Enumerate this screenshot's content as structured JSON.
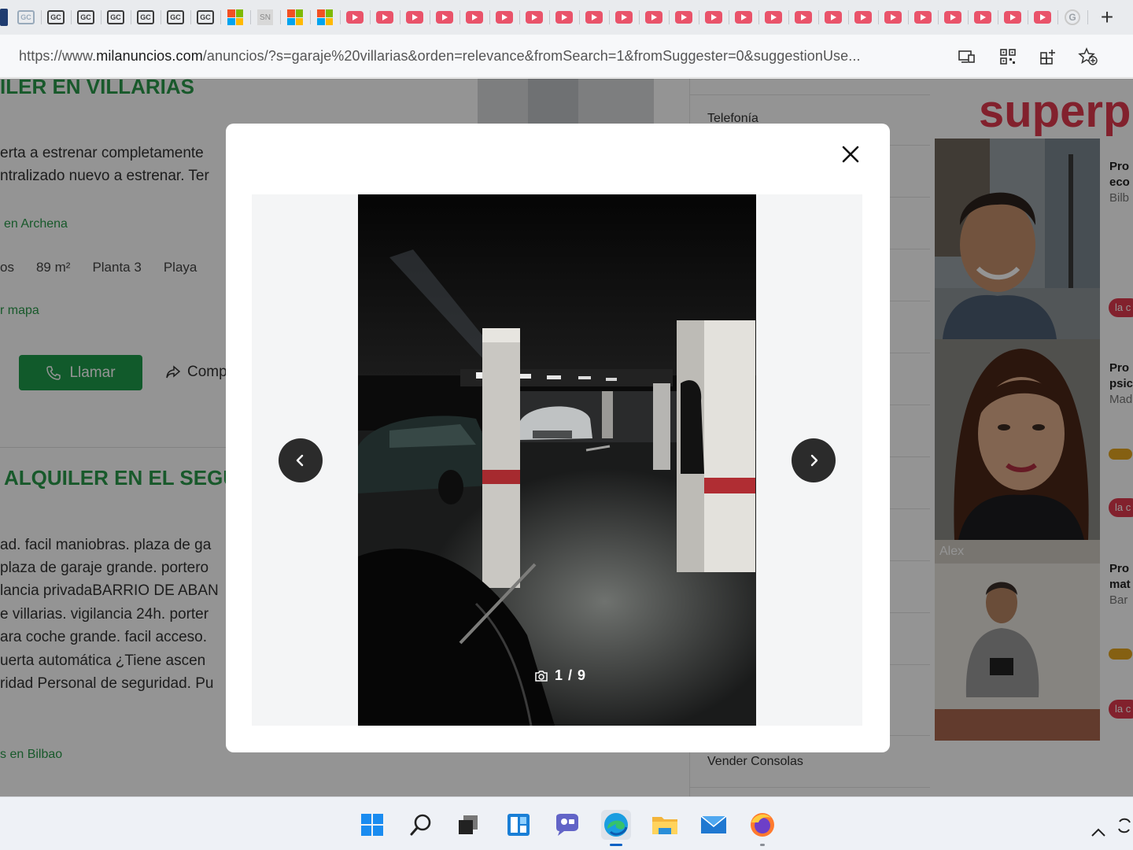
{
  "browser": {
    "tabs": [
      {
        "icon": "generic-dark-icon"
      },
      {
        "icon": "gc-icon",
        "label": "GC"
      },
      {
        "icon": "gc-icon",
        "label": "GC"
      },
      {
        "icon": "gc-icon",
        "label": "GC"
      },
      {
        "icon": "gc-icon",
        "label": "GC"
      },
      {
        "icon": "gc-icon",
        "label": "GC"
      },
      {
        "icon": "gc-icon",
        "label": "GC"
      },
      {
        "icon": "gc-icon",
        "label": "GC"
      },
      {
        "icon": "microsoft-icon"
      },
      {
        "icon": "sn-icon",
        "label": "SN"
      },
      {
        "icon": "microsoft-icon"
      },
      {
        "icon": "microsoft-icon"
      },
      {
        "icon": "youtube-icon"
      },
      {
        "icon": "youtube-icon"
      },
      {
        "icon": "youtube-icon"
      },
      {
        "icon": "youtube-icon"
      },
      {
        "icon": "youtube-icon"
      },
      {
        "icon": "youtube-icon"
      },
      {
        "icon": "youtube-icon"
      },
      {
        "icon": "youtube-icon"
      },
      {
        "icon": "youtube-icon"
      },
      {
        "icon": "youtube-icon"
      },
      {
        "icon": "youtube-icon"
      },
      {
        "icon": "youtube-icon"
      },
      {
        "icon": "youtube-icon"
      },
      {
        "icon": "youtube-icon"
      },
      {
        "icon": "youtube-icon"
      },
      {
        "icon": "youtube-icon"
      },
      {
        "icon": "youtube-icon"
      },
      {
        "icon": "youtube-icon"
      },
      {
        "icon": "youtube-icon"
      },
      {
        "icon": "youtube-icon"
      },
      {
        "icon": "youtube-icon"
      },
      {
        "icon": "youtube-icon"
      },
      {
        "icon": "youtube-icon"
      },
      {
        "icon": "youtube-icon"
      },
      {
        "icon": "google-icon",
        "label": "G"
      }
    ],
    "new_tab_label": "+",
    "url_prefix": "https://www.",
    "url_host": "milanuncios.com",
    "url_rest": "/anuncios/?s=garaje%20villarias&orden=relevance&fromSearch=1&fromSuggester=0&suggestionUse..."
  },
  "page": {
    "listing1": {
      "title": "ILER EN VILLARIAS",
      "desc_lines": [
        "erta a estrenar completamente",
        "ntralizado nuevo a estrenar. Ter"
      ],
      "location": "en Archena",
      "tags": [
        "os",
        "89 m²",
        "Planta 3",
        "Playa"
      ],
      "map_link": "r mapa",
      "call_label": "Llamar",
      "share_label": "Comp"
    },
    "listing2": {
      "title": "ALQUILER EN EL SEGUI",
      "desc_lines": [
        "ad. facil maniobras. plaza de ga",
        "plaza de garaje grande. portero",
        "lancia privadaBARRIO DE ABAN",
        "e villarias. vigilancia 24h. porter",
        "ara coche grande. facil acceso.",
        "uerta automática ¿Tiene ascen",
        "ridad Personal de seguridad. Pu"
      ],
      "location": "s en Bilbao"
    },
    "sidebar": {
      "top_item": "Telefonía",
      "bottom_item": "Vender Consolas"
    },
    "ad": {
      "brand": "superp",
      "cards": [
        {
          "line1": "Pro",
          "line2": "eco",
          "line3": "Bilb",
          "badge": "la c"
        },
        {
          "line1": "Pro",
          "line2": "psic",
          "line3": "Mad",
          "badge": "la c"
        },
        {
          "line1": "Pro",
          "line2": "mat",
          "line3": "Bar",
          "badge": "la c",
          "name": "Alex"
        }
      ]
    }
  },
  "modal": {
    "counter": "1 / 9",
    "current_index": 1,
    "total": 9
  },
  "taskbar": {
    "apps": [
      "windows-start-icon",
      "search-icon",
      "task-view-icon",
      "widgets-icon",
      "chat-icon",
      "edge-icon",
      "file-explorer-icon",
      "mail-icon",
      "firefox-icon"
    ],
    "active_app": "edge-icon"
  },
  "colors": {
    "accent_green": "#2a9a4a",
    "brand_red": "#e03a4e",
    "nav_button": "#2b2b2b"
  }
}
